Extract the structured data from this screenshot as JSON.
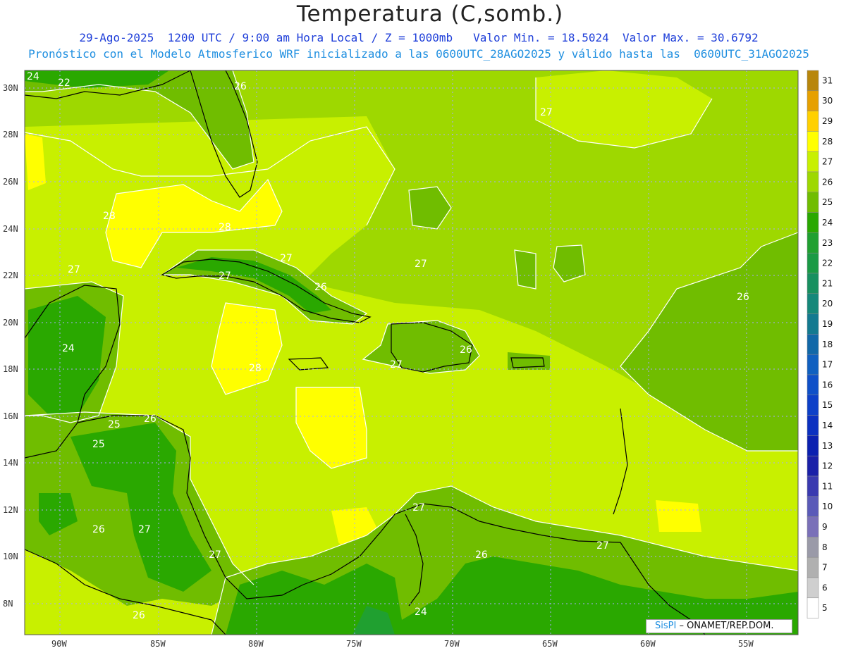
{
  "header": {
    "title": "Temperatura (C,somb.)",
    "line1": "29-Ago-2025  1200 UTC / 9:00 am Hora Local / Z = 1000mb   Valor Min. = 18.5024  Valor Max. = 30.6792",
    "line2": "Pronóstico con el Modelo Atmosferico WRF inicializado a las 0600UTC_28AGO2025 y válido hasta las  0600UTC_31AGO2025"
  },
  "axes": {
    "lat_labels": [
      "30N",
      "28N",
      "26N",
      "24N",
      "22N",
      "20N",
      "18N",
      "16N",
      "14N",
      "12N",
      "10N",
      "8N"
    ],
    "lon_labels": [
      "90W",
      "85W",
      "80W",
      "75W",
      "70W",
      "65W",
      "60W",
      "55W"
    ]
  },
  "colorbar": {
    "labels": [
      "31",
      "30",
      "29",
      "28",
      "27",
      "26",
      "25",
      "24",
      "23",
      "22",
      "21",
      "20",
      "19",
      "18",
      "17",
      "16",
      "15",
      "14",
      "13",
      "12",
      "11",
      "10",
      "9",
      "8",
      "7",
      "6",
      "5"
    ],
    "colors": [
      "#b8860b",
      "#e6a000",
      "#ffd000",
      "#ffff00",
      "#c8f000",
      "#9ed800",
      "#70bd00",
      "#2aa800",
      "#20a030",
      "#1a9a45",
      "#189060",
      "#15887a",
      "#137a90",
      "#1168a8",
      "#1060c0",
      "#0f50c8",
      "#0d40c8",
      "#0b30c0",
      "#0b20b0",
      "#1a20a8",
      "#3a3ab0",
      "#5a5ab8",
      "#7a70b8",
      "#9a9aa8",
      "#b0b0b0",
      "#cfcfcf",
      "#ffffff"
    ]
  },
  "contour_labels": [
    {
      "text": "24"
    },
    {
      "text": "22"
    },
    {
      "text": "26"
    },
    {
      "text": "27"
    },
    {
      "text": "28"
    },
    {
      "text": "28"
    },
    {
      "text": "27"
    },
    {
      "text": "27"
    },
    {
      "text": "27"
    },
    {
      "text": "26"
    },
    {
      "text": "27"
    },
    {
      "text": "24"
    },
    {
      "text": "28"
    },
    {
      "text": "26"
    },
    {
      "text": "27"
    },
    {
      "text": "26"
    },
    {
      "text": "25"
    },
    {
      "text": "25"
    },
    {
      "text": "26"
    },
    {
      "text": "26"
    },
    {
      "text": "27"
    },
    {
      "text": "27"
    },
    {
      "text": "26"
    },
    {
      "text": "27"
    },
    {
      "text": "24"
    },
    {
      "text": "26"
    },
    {
      "text": "27"
    }
  ],
  "credit": {
    "brand": "SisPI",
    "text": "ONAMET/REP.DOM."
  },
  "colors": {
    "base": "#9ed800",
    "warm": "#c8f000",
    "hot": "#ffff00",
    "cool": "#70bd00",
    "cold": "#2aa800",
    "coast": "#000000",
    "contour": "#ffffff"
  }
}
